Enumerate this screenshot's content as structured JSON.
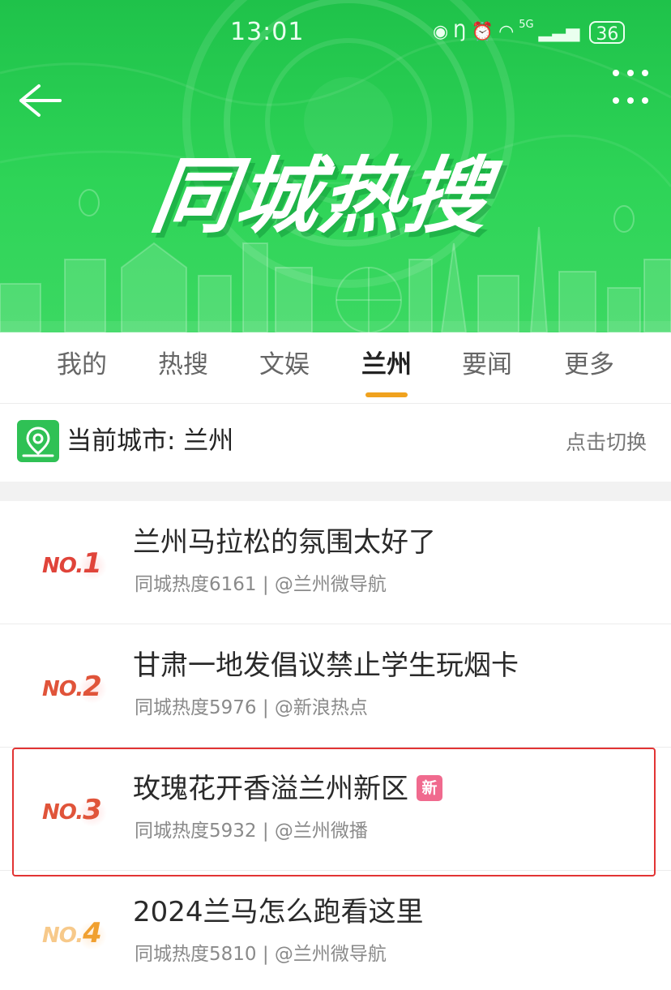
{
  "status_bar": {
    "time": "13:01",
    "icons": [
      "eye-icon",
      "nfc-icon",
      "alarm-icon",
      "wifi-icon",
      "signal-icon"
    ],
    "network_label": "5G",
    "battery": "36"
  },
  "header": {
    "title": "同城热搜",
    "back_icon": "back-arrow-icon",
    "more_icon": "more-dots-icon",
    "colors": {
      "green_top": "#1fc24a",
      "green_bottom": "#3bd862"
    }
  },
  "tabs": [
    {
      "label": "我的",
      "active": false
    },
    {
      "label": "热搜",
      "active": false
    },
    {
      "label": "文娱",
      "active": false
    },
    {
      "label": "兰州",
      "active": true
    },
    {
      "label": "要闻",
      "active": false
    },
    {
      "label": "更多",
      "active": false
    }
  ],
  "accent_color": "#f0a21e",
  "city_bar": {
    "icon": "location-pin-icon",
    "label": "当前城市: 兰州",
    "switch_label": "点击切换"
  },
  "list": [
    {
      "rank_prefix": "NO.",
      "rank": "1",
      "title": "兰州马拉松的氛围太好了",
      "meta": "同城热度6161 | @兰州微导航",
      "badge": "",
      "rank_color": "#e0443a"
    },
    {
      "rank_prefix": "NO.",
      "rank": "2",
      "title": "甘肃一地发倡议禁止学生玩烟卡",
      "meta": "同城热度5976 | @新浪热点",
      "badge": "",
      "rank_color": "#e0543a"
    },
    {
      "rank_prefix": "NO.",
      "rank": "3",
      "title": "玫瑰花开香溢兰州新区",
      "meta": "同城热度5932 | @兰州微播",
      "badge": "新",
      "rank_color": "#e0543a"
    },
    {
      "rank_prefix": "NO.",
      "rank": "4",
      "title": "2024兰马怎么跑看这里",
      "meta": "同城热度5810 | @兰州微导航",
      "badge": "",
      "rank_color": "#f0a030"
    }
  ],
  "highlight_color": "#e23434"
}
